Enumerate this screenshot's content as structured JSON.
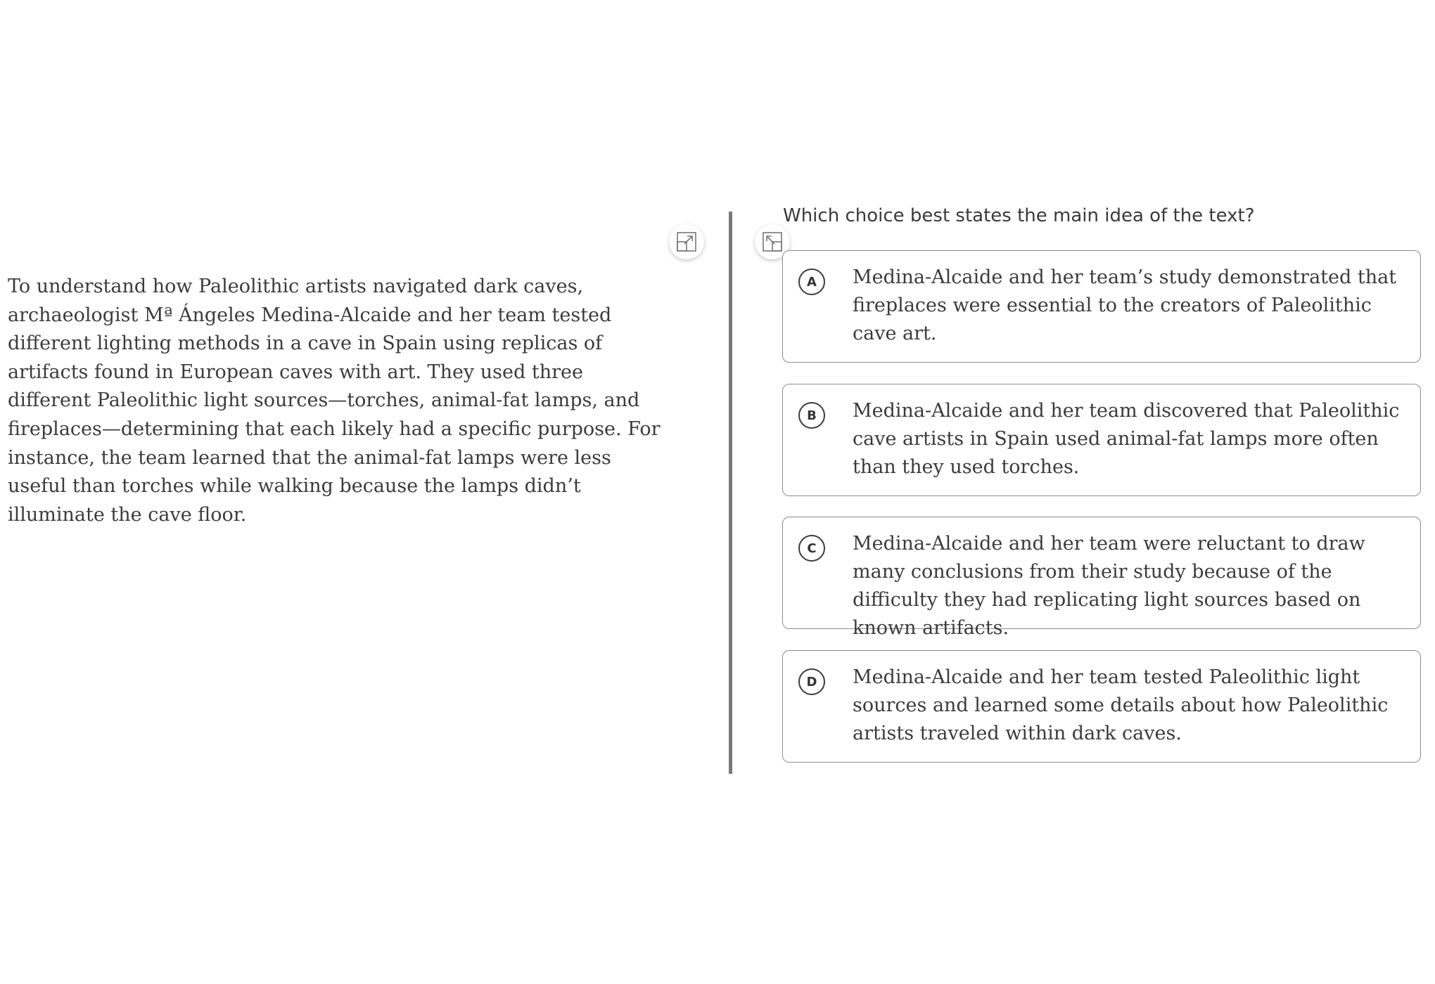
{
  "passage": {
    "text": "To understand how Paleolithic artists navigated dark caves, archaeologist Mª Ángeles Medina-Alcaide and her team tested different lighting methods in a cave in Spain using replicas of artifacts found in European caves with art. They used three different Paleolithic light sources—torches, animal-fat lamps, and fireplaces—determining that each likely had a specific purpose. For instance, the team learned that the animal-fat lamps were less useful than torches while walking because the lamps didn’t illuminate the cave floor."
  },
  "icons": {
    "expand_left": "expand-arrow-icon",
    "expand_right": "collapse-arrow-icon"
  },
  "question": {
    "prompt": "Which choice best states the main idea of the text?",
    "choices": [
      {
        "letter": "A",
        "text": "Medina-Alcaide and her team’s study demonstrated that fireplaces were essential to the creators of Paleolithic cave art."
      },
      {
        "letter": "B",
        "text": "Medina-Alcaide and her team discovered that Paleolithic cave artists in Spain used animal-fat lamps more often than they used torches."
      },
      {
        "letter": "C",
        "text": "Medina-Alcaide and her team were reluctant to draw many conclusions from their study because of the difficulty they had replicating light sources based on known artifacts."
      },
      {
        "letter": "D",
        "text": "Medina-Alcaide and her team tested Paleolithic light sources and learned some details about how Paleolithic artists traveled within dark caves."
      }
    ]
  },
  "colors": {
    "border": "#8c8c8c",
    "divider": "#7a7a7a",
    "text": "#3b3b3b"
  }
}
